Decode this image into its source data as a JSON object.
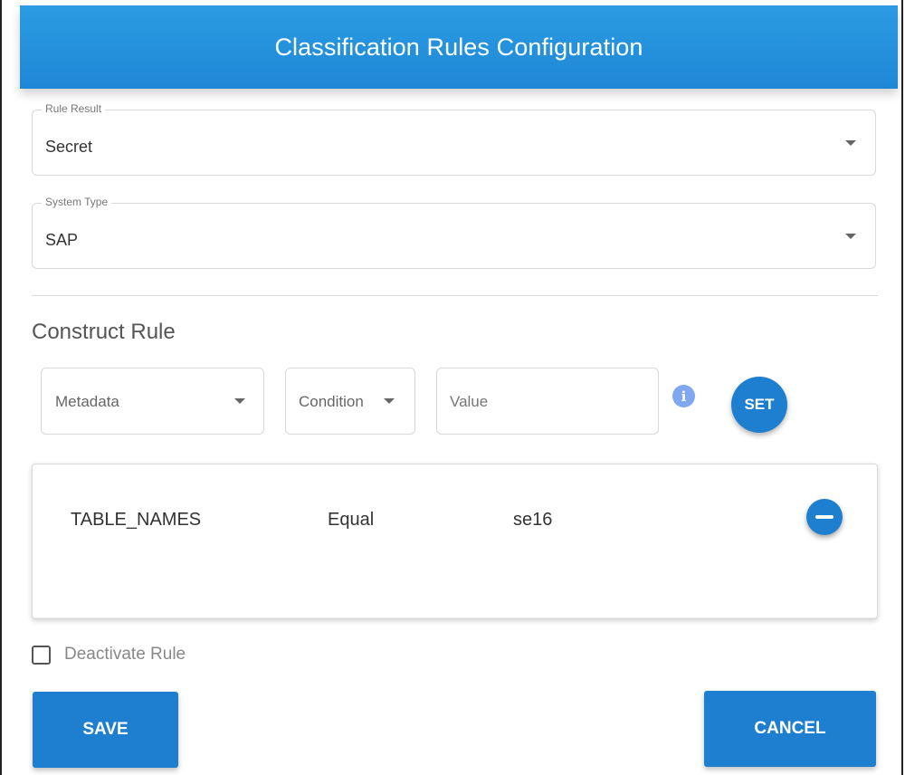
{
  "header": {
    "title": "Classification Rules Configuration"
  },
  "rule_result": {
    "label": "Rule Result",
    "value": "Secret"
  },
  "system_type": {
    "label": "System Type",
    "value": "SAP"
  },
  "construct_rule": {
    "title": "Construct Rule",
    "metadata_placeholder": "Metadata",
    "condition_placeholder": "Condition",
    "value_placeholder": "Value",
    "info_icon": "info-icon",
    "set_label": "SET"
  },
  "rules": [
    {
      "metadata": "TABLE_NAMES",
      "condition": "Equal",
      "value": "se16"
    }
  ],
  "deactivate": {
    "label": "Deactivate Rule",
    "checked": false
  },
  "actions": {
    "save_label": "SAVE",
    "cancel_label": "CANCEL"
  },
  "colors": {
    "primary": "#1E7FD0",
    "header": "#2C9BE3",
    "info": "#7FA8F0"
  }
}
